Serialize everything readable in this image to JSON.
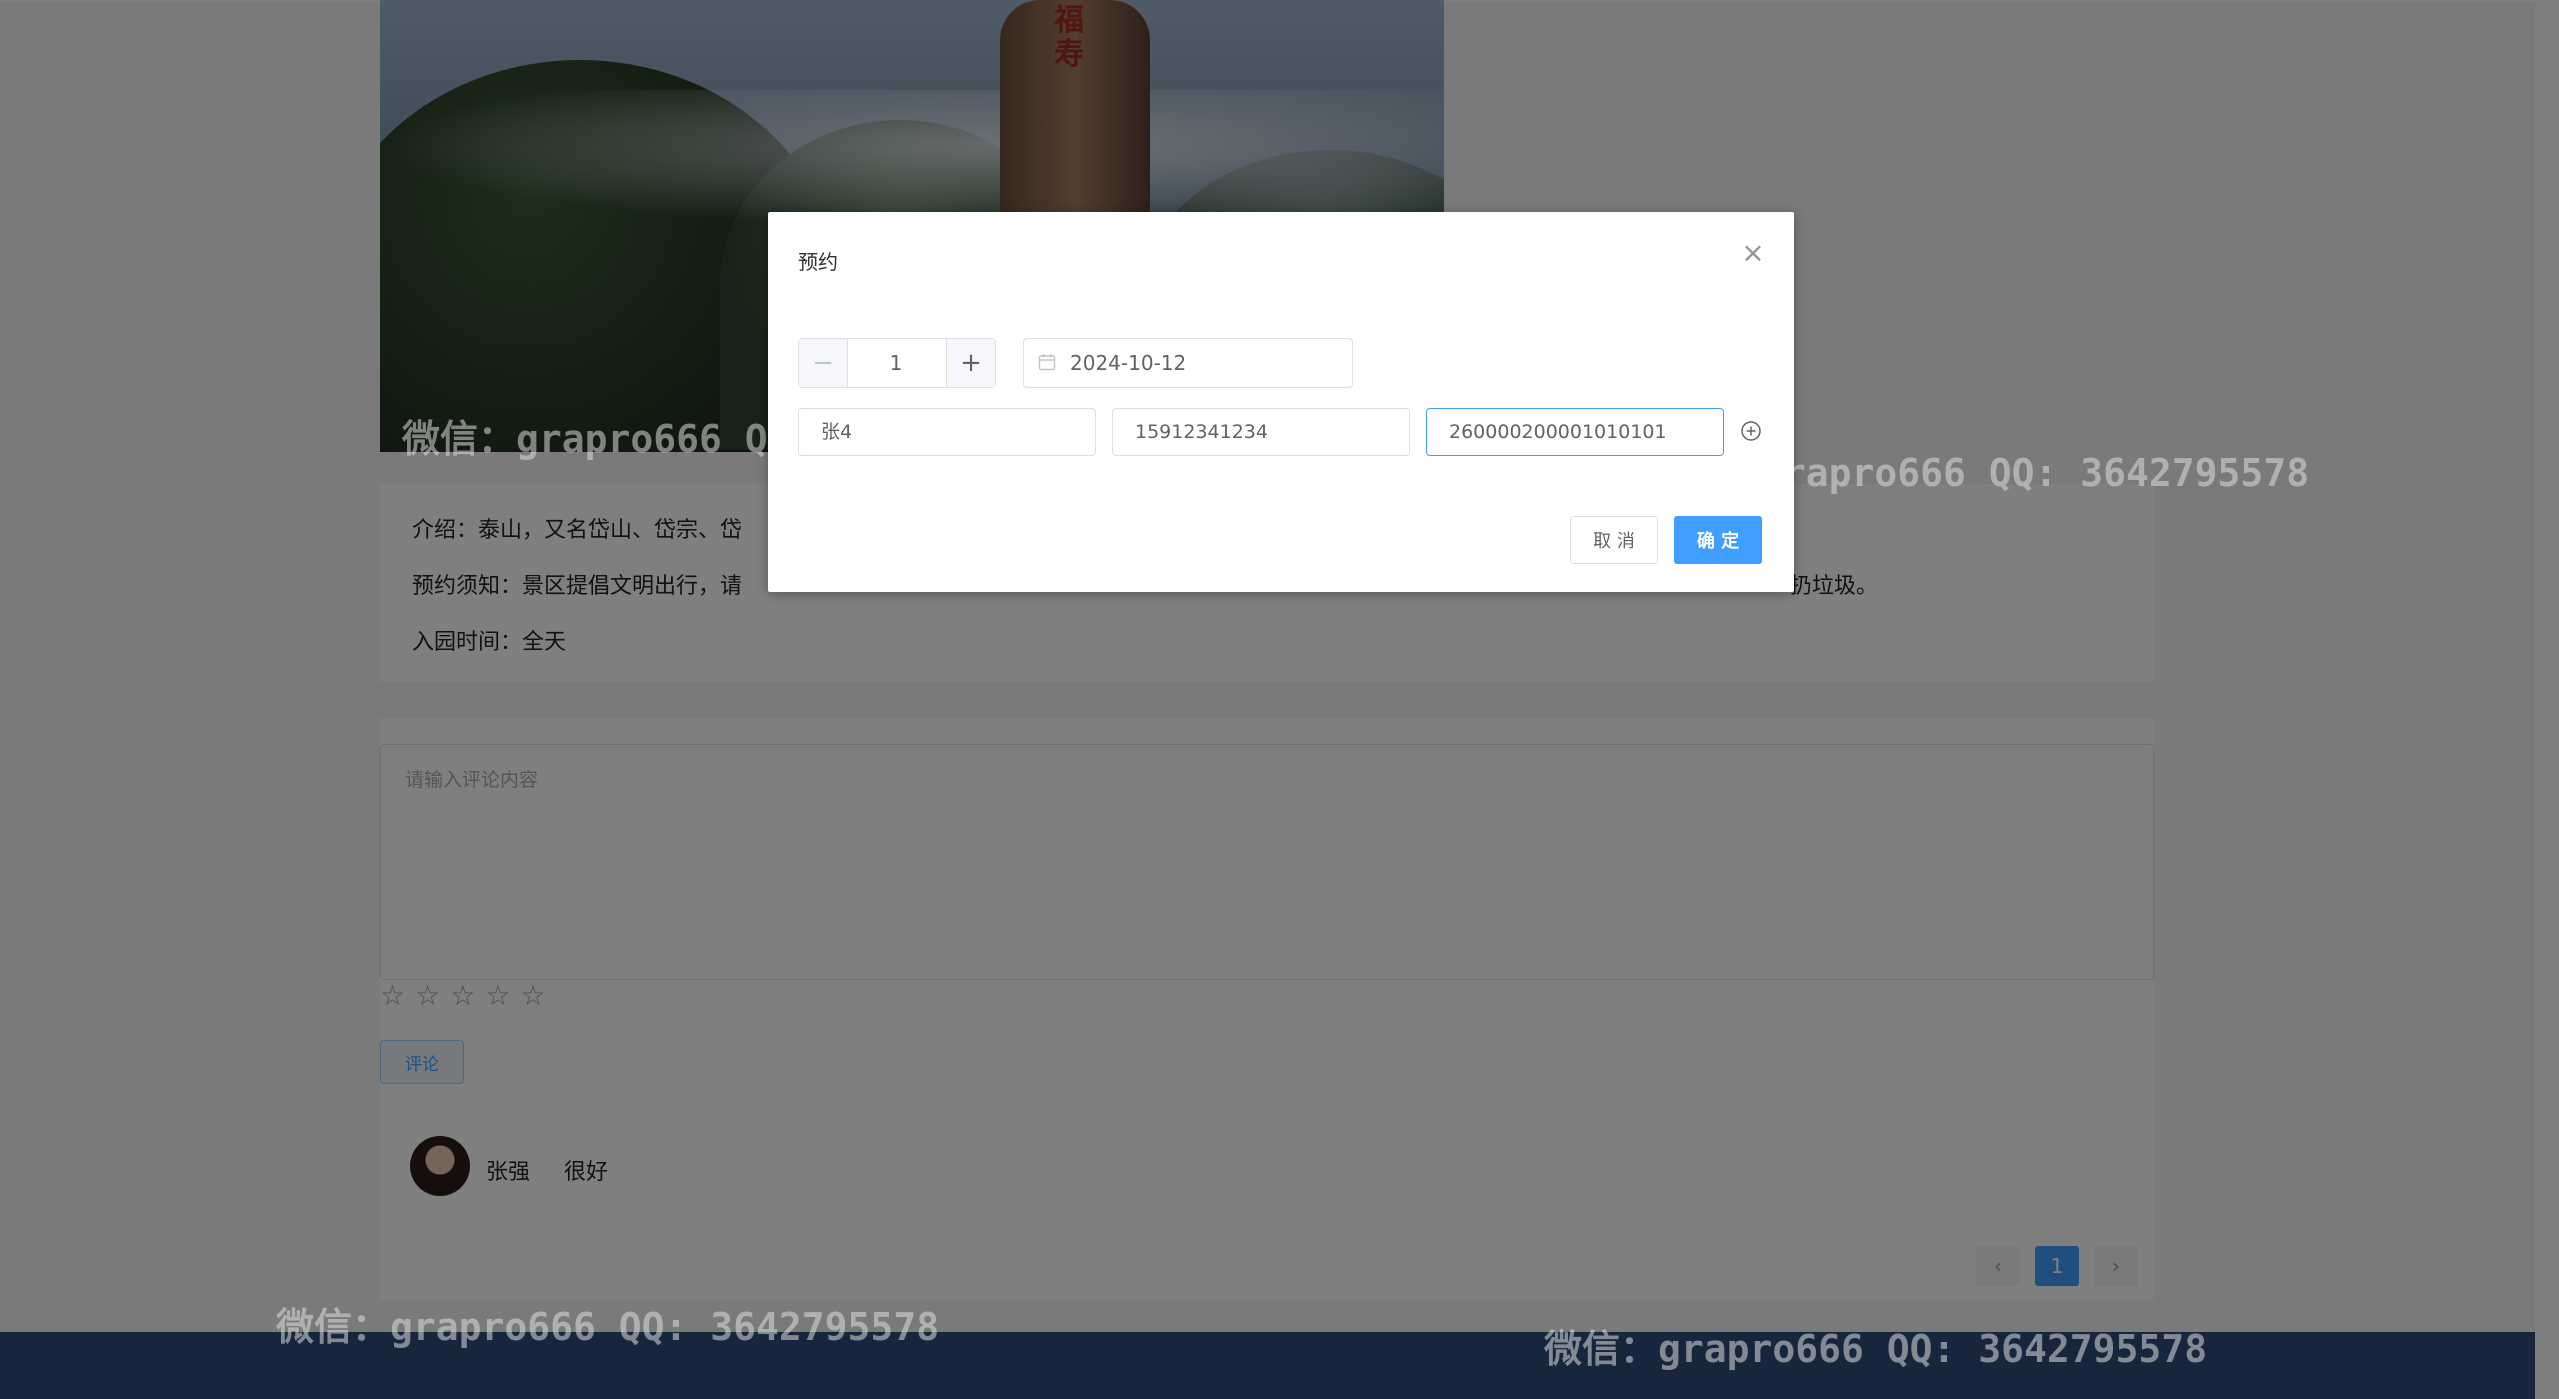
{
  "hero": {
    "rock_text": "福寿"
  },
  "info": {
    "intro": "介绍：泰山，又名岱山、岱宗、岱",
    "notice": "预约须知：景区提倡文明出行，请",
    "notice_tail": "扔垃圾。",
    "open_time": "入园时间：全天"
  },
  "comment": {
    "placeholder": "请输入评论内容",
    "stars": [
      "☆",
      "☆",
      "☆",
      "☆",
      "☆"
    ],
    "submit_label": "评论"
  },
  "comment_list": [
    {
      "user": "张强",
      "text": "很好"
    }
  ],
  "pagination": {
    "prev": "‹",
    "page": "1",
    "next": "›"
  },
  "watermark": "微信：grapro666 QQ: 3642795578",
  "dialog": {
    "title": "预约",
    "close": "×",
    "quantity": "1",
    "minus": "−",
    "plus": "+",
    "date": "2024-10-12",
    "name_value": "张4",
    "phone_value": "15912341234",
    "id_value": "260000200001010101",
    "cancel_label": "取 消",
    "confirm_label": "确 定"
  }
}
